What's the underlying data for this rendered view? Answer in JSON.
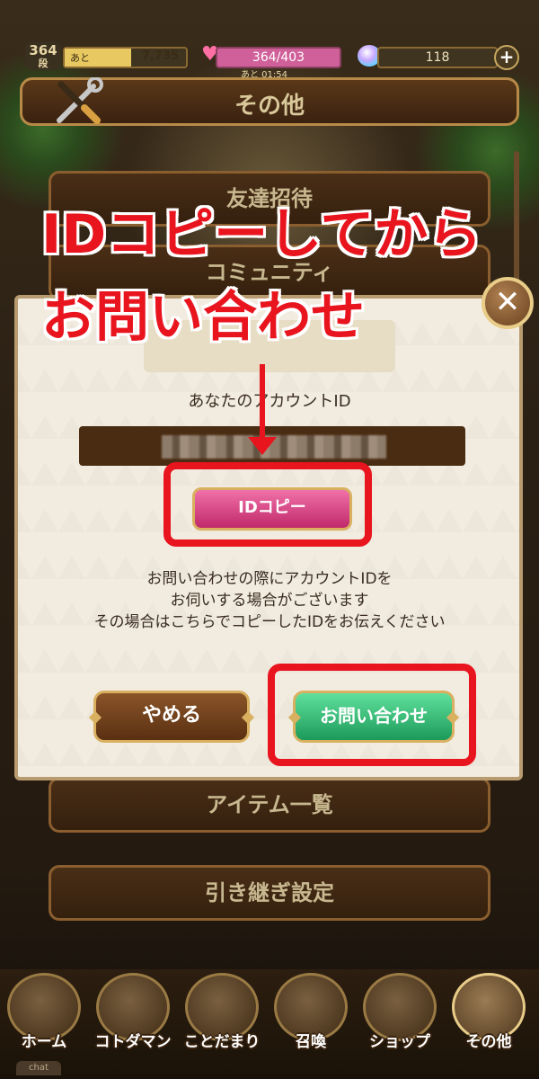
{
  "status": {
    "rank": "364",
    "rank_unit": "段",
    "exp_label": "あと",
    "exp_value": "7,735",
    "exp_fill": 0.55,
    "stamina": "364/403",
    "stamina_timer": "あと 01:54",
    "gems": "118",
    "plus": "+"
  },
  "header": {
    "title": "その他"
  },
  "menu": {
    "items": [
      "友達招待",
      "コミュニティ",
      "アイテム一覧",
      "引き継ぎ設定"
    ]
  },
  "dialog": {
    "account_label": "あなたのアカウントID",
    "copy_button": "IDコピー",
    "note_lines": [
      "お問い合わせの際にアカウントIDを",
      "お伺いする場合がございます",
      "その場合はこちらでコピーしたIDをお伝えください"
    ],
    "cancel_button": "やめる",
    "inquiry_button": "お問い合わせ",
    "close": "✕"
  },
  "annotation": {
    "line1": "IDコピーしてから",
    "line2": "お問い合わせ",
    "color": "#e8141e"
  },
  "nav": {
    "items": [
      "ホーム",
      "コトダマン",
      "ことだまり",
      "召喚",
      "ショップ",
      "その他"
    ],
    "active": "その他"
  },
  "chat_tab": "chat"
}
